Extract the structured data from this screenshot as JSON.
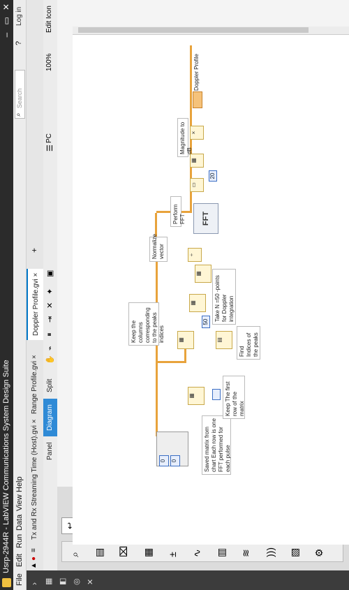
{
  "window": {
    "title": "Usrp-2944R - LabVIEW Communications System Design Suite"
  },
  "menu": {
    "file": "File",
    "edit": "Edit",
    "run": "Run",
    "data": "Data",
    "view": "View",
    "help": "Help",
    "search_placeholder": "Search",
    "login": "Log in"
  },
  "tabs": [
    {
      "label": "Tx and Rx Streaming Time (Host).gvi"
    },
    {
      "label": "Range Profile.gvi"
    },
    {
      "label": "Doppler Profile.gvi"
    }
  ],
  "view_buttons": {
    "panel": "Panel",
    "diagram": "Diagram",
    "split": "Split"
  },
  "toolbar": {
    "target": "PC",
    "zoom": "100%",
    "edit_icon": "Edit Icon"
  },
  "notes": {
    "saved_matrix": "Saved matrix from chart Each row is one FFT performed for each pulse",
    "keep_first_row": "Keep The first row of the matrix",
    "find_indices": "Find Indices of the peaks",
    "keep_columns": "Keep the columns corresponding to the peaks indices",
    "take_n": "Take N =50 -points for Doppler integration",
    "normalize": "Normalize vector",
    "perform_fft": "Perform FFT",
    "magnitude_db": "Magnitude to dB",
    "doppler_profile": "Doppler Profile"
  },
  "constants": {
    "zero_a": "0",
    "zero_b": "0",
    "fifty": "50",
    "twenty": "20"
  },
  "nodes": {
    "fft": "FFT"
  },
  "colors": {
    "wire_orange": "#e8a33c",
    "wire_blue": "#3b6ec4",
    "accent": "#2f8ad6"
  }
}
